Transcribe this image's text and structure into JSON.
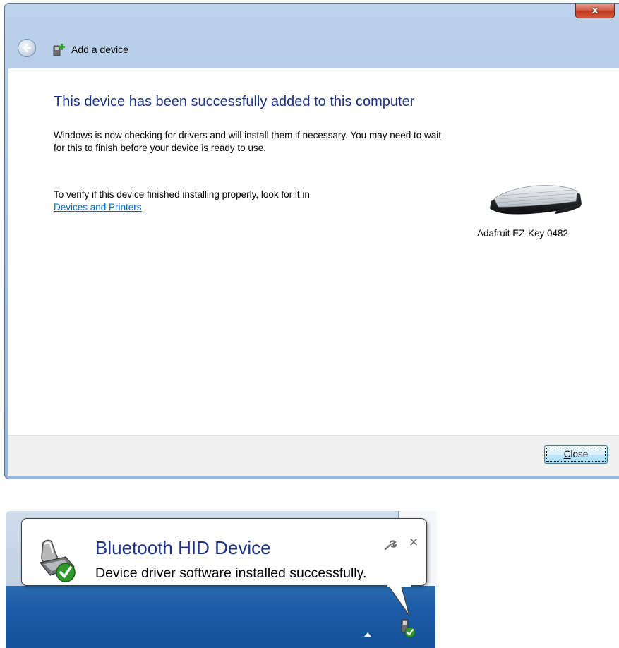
{
  "dialog": {
    "title": "Add a device",
    "close_glyph": "x",
    "heading": "This device has been successfully added to this computer",
    "paragraph1": "Windows is now checking for drivers and will install them if necessary. You may need to wait for this to finish before your device is ready to use.",
    "paragraph2_prefix": "To verify if this device finished installing properly, look for it in",
    "paragraph2_link": "Devices and Printers",
    "paragraph2_suffix": ".",
    "device_name": "Adafruit EZ-Key 0482",
    "device_icon": "keyboard-icon",
    "close_button_accel": "C",
    "close_button_rest": "lose",
    "heading_color": "#1e3287",
    "link_color": "#0066cc"
  },
  "notification": {
    "title": "Bluetooth HID Device",
    "message": "Device driver software installed successfully.",
    "close_glyph": "✕",
    "icons": [
      "device-installed-icon",
      "wrench-icon",
      "close-icon",
      "show-hidden-icons-icon",
      "device-tray-icon"
    ],
    "taskbar_color": "#1d5ea8"
  }
}
